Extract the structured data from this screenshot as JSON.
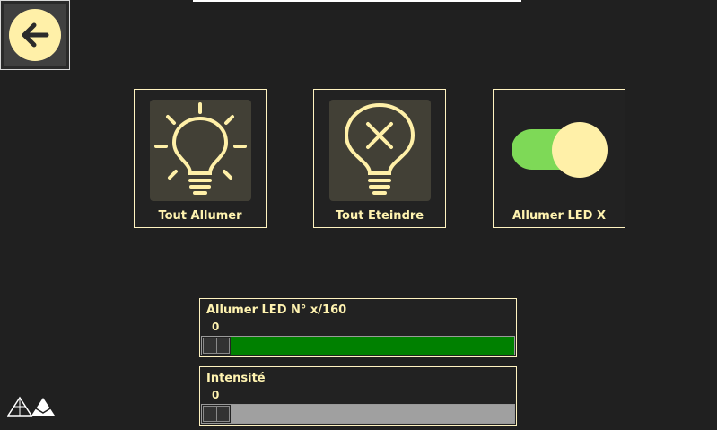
{
  "tiles": [
    {
      "label": "Tout Allumer",
      "icon": "lightbulb-on-icon"
    },
    {
      "label": "Tout Eteindre",
      "icon": "lightbulb-off-icon"
    },
    {
      "label": "Allumer LED X",
      "icon": "toggle-switch-icon"
    }
  ],
  "sliders": [
    {
      "title": "Allumer LED N° x/160",
      "value": "0",
      "level": 0,
      "fill_color": "#008000"
    },
    {
      "title": "Intensité",
      "value": "0",
      "level": 0,
      "fill_color": "#a0a0a0"
    }
  ],
  "colors": {
    "accent": "#fff0a8",
    "background": "#202020",
    "toggle_green": "#7ed957",
    "icon_box": "#424036"
  }
}
